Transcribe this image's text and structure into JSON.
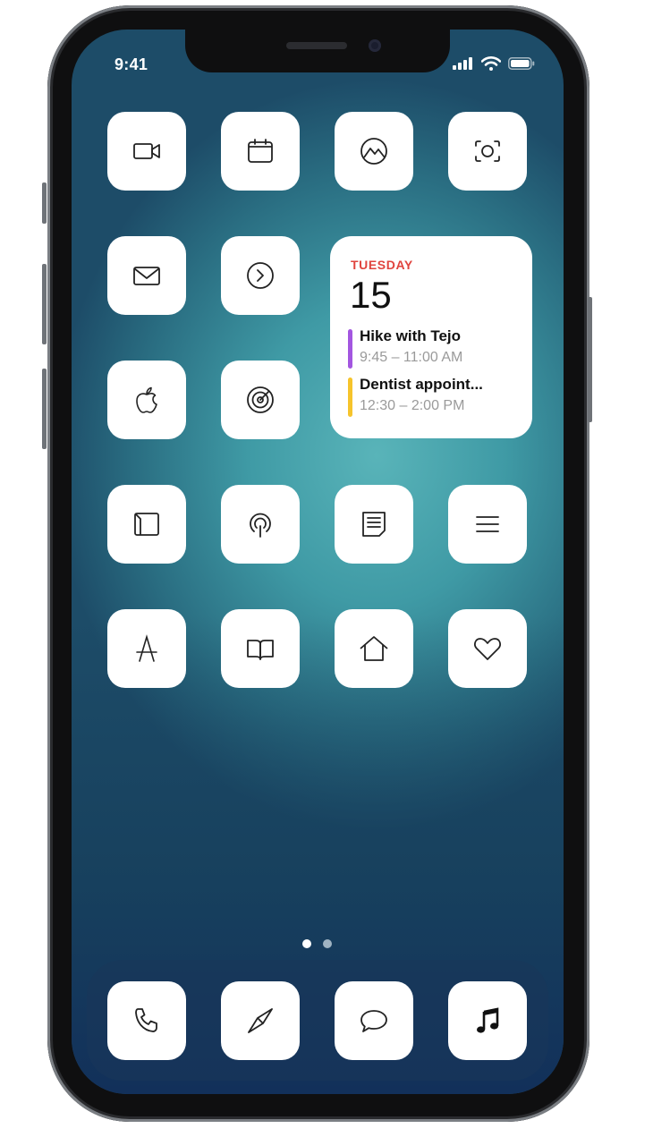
{
  "status": {
    "time": "9:41"
  },
  "apps_row1": [
    {
      "name": "facetime",
      "icon": "video-camera-icon"
    },
    {
      "name": "calendar",
      "icon": "calendar-icon"
    },
    {
      "name": "photos",
      "icon": "mountain-icon"
    },
    {
      "name": "camera",
      "icon": "camera-viewfinder-icon"
    }
  ],
  "widget": {
    "day": "TUESDAY",
    "date": "15",
    "events": [
      {
        "title": "Hike with Tejo",
        "time": "9:45 – 11:00 AM",
        "color": "#a356e0"
      },
      {
        "title": "Dentist appoint...",
        "time": "12:30 – 2:00 PM",
        "color": "#f6c42c"
      }
    ]
  },
  "dock": [
    "phone-icon",
    "compass-icon",
    "message-icon",
    "music-note-icon"
  ],
  "page_indicator": {
    "pages": 2,
    "current": 1
  },
  "colors": {
    "widget_day": "#e0443e",
    "dot_active": "#ffffff",
    "dot_inactive": "#9fb3c2"
  }
}
